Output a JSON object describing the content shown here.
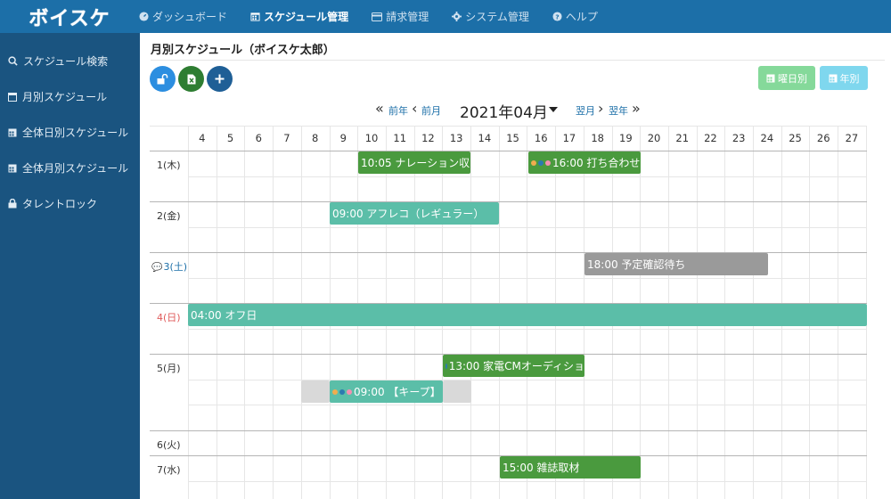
{
  "app": {
    "logo_text": "ボイスケ"
  },
  "nav": [
    {
      "icon": "dashboard-icon",
      "label": "ダッシュボード"
    },
    {
      "icon": "calendar-icon",
      "label": "スケジュール管理",
      "active": true
    },
    {
      "icon": "credit-card-icon",
      "label": "請求管理"
    },
    {
      "icon": "gear-icon",
      "label": "システム管理"
    },
    {
      "icon": "question-icon",
      "label": "ヘルプ"
    }
  ],
  "sidebar": [
    {
      "icon": "search-icon",
      "label": "スケジュール検索"
    },
    {
      "icon": "calendar-outline-icon",
      "label": "月別スケジュール"
    },
    {
      "icon": "calendar-grid-icon",
      "label": "全体日別スケジュール"
    },
    {
      "icon": "calendar-grid-icon",
      "label": "全体月別スケジュール"
    },
    {
      "icon": "lock-icon",
      "label": "タレントロック"
    }
  ],
  "page": {
    "title": "月別スケジュール（ボイスケ太郎）",
    "view_buttons": {
      "weekday": "曜日別",
      "year": "年別"
    }
  },
  "month_nav": {
    "prev_year": "前年",
    "prev_month": "前月",
    "current": "2021年04月",
    "next_month": "翌月",
    "next_year": "翌年"
  },
  "hours": [
    "4",
    "5",
    "6",
    "7",
    "8",
    "9",
    "10",
    "11",
    "12",
    "13",
    "14",
    "15",
    "16",
    "17",
    "18",
    "19",
    "20",
    "21",
    "22",
    "23",
    "24",
    "25",
    "26",
    "27"
  ],
  "days": [
    {
      "label": "1(木)"
    },
    {
      "label": "2(金)"
    },
    {
      "label": "3(土)",
      "type": "sat",
      "comment": true
    },
    {
      "label": "4(日)",
      "type": "sun"
    },
    {
      "label": "5(月)"
    },
    {
      "label": "6(火)"
    },
    {
      "label": "7(水)"
    }
  ],
  "events": [
    {
      "title": "10:05 ナレーション収",
      "color": "#4a9a3e"
    },
    {
      "title": "16:00 打ち合わせ",
      "color": "#4a9a3e",
      "dots": [
        "#f0ad4e",
        "#2c7ab0",
        "#f48fb1"
      ]
    },
    {
      "title": "09:00 アフレコ（レギュラー）",
      "color": "#5bbea8"
    },
    {
      "title": "18:00 予定確認待ち",
      "color": "#9a9a9a"
    },
    {
      "title": "04:00 オフ日",
      "color": "#5bbea8"
    },
    {
      "title": "13:00 家電CMオーディショ",
      "color": "#4a9a3e",
      "dots": [
        "#2c7ab0"
      ]
    },
    {
      "title": "09:00 【キープ】",
      "color": "#5bbea8",
      "dots": [
        "#f0ad4e",
        "#2c7ab0",
        "#f48fb1"
      ]
    },
    {
      "title": "15:00 雑誌取材",
      "color": "#4a9a3e"
    }
  ]
}
